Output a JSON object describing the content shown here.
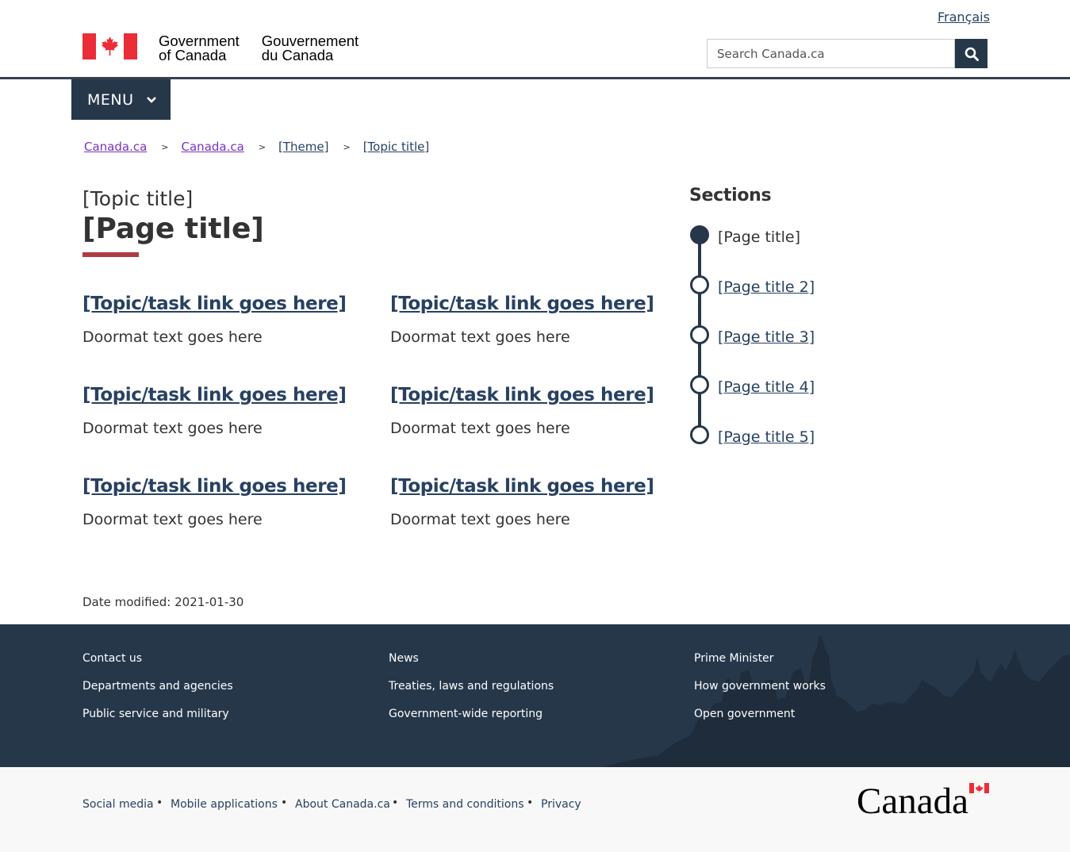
{
  "header": {
    "language_link": "Français",
    "gov_en_line1": "Government",
    "gov_en_line2": "of Canada",
    "gov_fr_line1": "Gouvernement",
    "gov_fr_line2": "du Canada",
    "search_placeholder": "Search Canada.ca",
    "search_icon": "magnifying-glass-icon",
    "menu_label": "MENU"
  },
  "breadcrumb": [
    {
      "label": "Canada.ca"
    },
    {
      "label": "Canada.ca"
    },
    {
      "label": "[Theme]"
    },
    {
      "label": "[Topic title]"
    }
  ],
  "main": {
    "topic_title": "[Topic title]",
    "page_title": "[Page title]",
    "doormats": [
      {
        "link": "[Topic/task link goes here]",
        "text": "Doormat text goes here"
      },
      {
        "link": "[Topic/task link goes here]",
        "text": "Doormat text goes here"
      },
      {
        "link": "[Topic/task link goes here]",
        "text": "Doormat text goes here"
      },
      {
        "link": "[Topic/task link goes here]",
        "text": "Doormat text goes here"
      },
      {
        "link": "[Topic/task link goes here]",
        "text": "Doormat text goes here"
      },
      {
        "link": "[Topic/task link goes here]",
        "text": "Doormat text goes here"
      }
    ],
    "date_modified_label": "Date modified:",
    "date_modified_value": "2021-01-30"
  },
  "sections": {
    "heading": "Sections",
    "items": [
      {
        "label": "[Page title]"
      },
      {
        "label": "[Page title 2]"
      },
      {
        "label": "[Page title 3]"
      },
      {
        "label": "[Page title 4]"
      },
      {
        "label": "[Page title 5]"
      }
    ]
  },
  "footer": {
    "columns": [
      [
        "Contact us",
        "Departments and agencies",
        "Public service and military"
      ],
      [
        "News",
        "Treaties, laws and regulations",
        "Government-wide reporting"
      ],
      [
        "Prime Minister",
        "How government works",
        "Open government"
      ]
    ],
    "sub_links": [
      "Social media",
      "Mobile applications",
      "About Canada.ca",
      "Terms and conditions",
      "Privacy"
    ],
    "wordmark": "Canada"
  },
  "colors": {
    "accent_red": "#af3c43",
    "navy": "#26374a",
    "link": "#284162",
    "visited": "#7834bc",
    "flag_red": "#eb2d37"
  }
}
